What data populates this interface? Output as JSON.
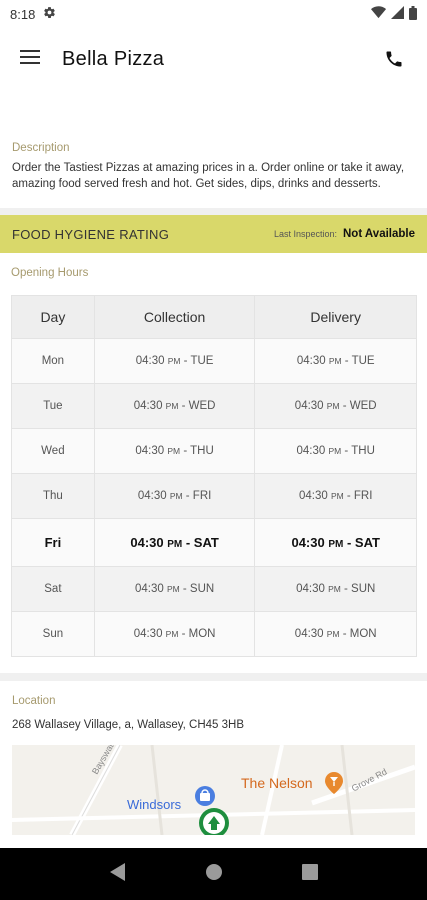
{
  "status_bar": {
    "time": "8:18",
    "icons": [
      "settings-icon",
      "wifi-icon",
      "signal-icon",
      "battery-icon"
    ]
  },
  "app_bar": {
    "title": "Bella Pizza",
    "menu_icon": "hamburger-menu-icon",
    "phone_icon": "phone-icon"
  },
  "description": {
    "label": "Description",
    "text": "Order the Tastiest Pizzas at amazing prices in a. Order online or take it away, amazing food served fresh and hot. Get sides, dips, drinks and desserts."
  },
  "hygiene": {
    "title": "FOOD HYGIENE RATING",
    "inspection_label": "Last Inspection:",
    "inspection_value": "Not Available"
  },
  "opening_hours": {
    "label": "Opening Hours",
    "headers": [
      "Day",
      "Collection",
      "Delivery"
    ],
    "rows": [
      {
        "day": "Mon",
        "c_time": "04:30",
        "c_ampm": "PM",
        "c_until": " - TUE",
        "d_time": "04:30",
        "d_ampm": "PM",
        "d_until": " - TUE"
      },
      {
        "day": "Tue",
        "c_time": "04:30",
        "c_ampm": "PM",
        "c_until": " - WED",
        "d_time": "04:30",
        "d_ampm": "PM",
        "d_until": " - WED"
      },
      {
        "day": "Wed",
        "c_time": "04:30",
        "c_ampm": "PM",
        "c_until": " - THU",
        "d_time": "04:30",
        "d_ampm": "PM",
        "d_until": " - THU"
      },
      {
        "day": "Thu",
        "c_time": "04:30",
        "c_ampm": "PM",
        "c_until": " - FRI",
        "d_time": "04:30",
        "d_ampm": "PM",
        "d_until": " - FRI"
      },
      {
        "day": "Fri",
        "c_time": "04:30",
        "c_ampm": "PM",
        "c_until": " - SAT",
        "d_time": "04:30",
        "d_ampm": "PM",
        "d_until": " - SAT"
      },
      {
        "day": "Sat",
        "c_time": "04:30",
        "c_ampm": "PM",
        "c_until": " - SUN",
        "d_time": "04:30",
        "d_ampm": "PM",
        "d_until": " - SUN"
      },
      {
        "day": "Sun",
        "c_time": "04:30",
        "c_ampm": "PM",
        "c_until": " - MON",
        "d_time": "04:30",
        "d_ampm": "PM",
        "d_until": " - MON"
      }
    ],
    "current_day": "Fri"
  },
  "location": {
    "label": "Location",
    "address": "268 Wallasey Village, a, Wallasey, CH45 3HB",
    "map_labels": {
      "nelson": "The Nelson",
      "windsors": "Windsors",
      "bayswater": "Bayswater Rd",
      "grove": "Grove Rd"
    }
  },
  "colors": {
    "hygiene_bg": "#d9d86a",
    "section_label": "#a69a6e",
    "map_pub": "#d4691e",
    "map_shop": "#3a6bd8",
    "map_pin": "#1e8e3e"
  },
  "nav_bar": {
    "icons": [
      "back-icon",
      "home-icon",
      "recents-icon"
    ]
  }
}
